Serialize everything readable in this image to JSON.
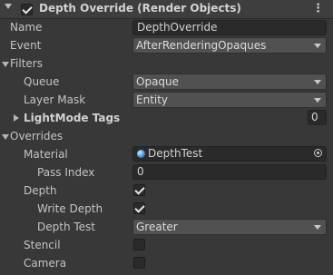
{
  "header": {
    "title": "Depth Override (Render Objects)",
    "enabled": true
  },
  "name": {
    "label": "Name",
    "value": "DepthOverride"
  },
  "event": {
    "label": "Event",
    "value": "AfterRenderingOpaques"
  },
  "filters": {
    "label": "Filters",
    "queue": {
      "label": "Queue",
      "value": "Opaque"
    },
    "layer_mask": {
      "label": "Layer Mask",
      "value": "Entity"
    },
    "lightmode_tags": {
      "label": "LightMode Tags",
      "value": "0"
    }
  },
  "overrides": {
    "label": "Overrides",
    "material": {
      "label": "Material",
      "value": "DepthTest"
    },
    "pass_index": {
      "label": "Pass Index",
      "value": "0"
    },
    "depth": {
      "label": "Depth",
      "checked": true
    },
    "write_depth": {
      "label": "Write Depth",
      "checked": true
    },
    "depth_test": {
      "label": "Depth Test",
      "value": "Greater"
    },
    "stencil": {
      "label": "Stencil",
      "checked": false
    },
    "camera": {
      "label": "Camera",
      "checked": false
    }
  }
}
